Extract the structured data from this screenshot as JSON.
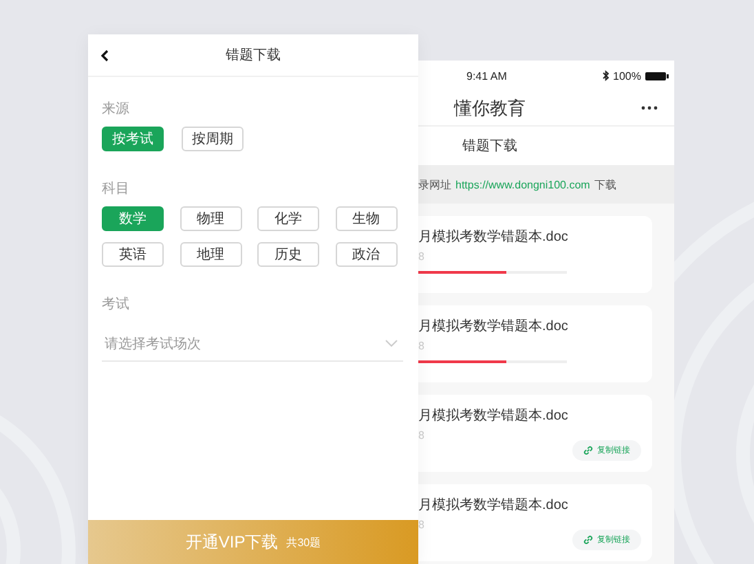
{
  "left_screen": {
    "title": "错题下载",
    "sections": [
      {
        "label": "来源",
        "options": [
          {
            "label": "按考试",
            "selected": true
          },
          {
            "label": "按周期",
            "selected": false
          }
        ]
      },
      {
        "label": "科目",
        "options": [
          {
            "label": "数学",
            "selected": true
          },
          {
            "label": "物理",
            "selected": false
          },
          {
            "label": "化学",
            "selected": false
          },
          {
            "label": "生物",
            "selected": false
          },
          {
            "label": "英语",
            "selected": false
          },
          {
            "label": "地理",
            "selected": false
          },
          {
            "label": "历史",
            "selected": false
          },
          {
            "label": "政治",
            "selected": false
          }
        ]
      }
    ],
    "exam": {
      "label": "考试",
      "placeholder": "请选择考试场次"
    },
    "vip_button": {
      "label": "开通VIP下载",
      "count": "共30题"
    }
  },
  "right_screen": {
    "status_bar": {
      "time": "9:41 AM",
      "battery": "100%"
    },
    "app_title": "懂你教育",
    "page_title": "错题下载",
    "notice": {
      "prefix": "录网址",
      "url": "https://www.dongni100.com",
      "suffix": "下载"
    },
    "files": [
      {
        "kind": "progress",
        "name": "月模拟考数学错题本.doc",
        "size": "8",
        "level": 0.59
      },
      {
        "kind": "progress",
        "name": "月模拟考数学错题本.doc",
        "size": "8",
        "level": 0.59
      },
      {
        "kind": "link",
        "name": "月模拟考数学错题本.doc",
        "size": "8",
        "action": "复制链接"
      },
      {
        "kind": "link",
        "name": "月模拟考数学错题本.doc",
        "size": "8",
        "action": "复制链接"
      }
    ]
  }
}
